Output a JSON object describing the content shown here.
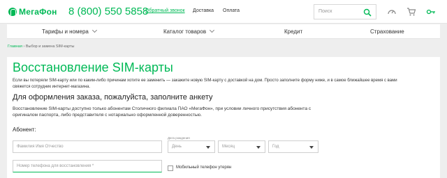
{
  "header": {
    "logo": "МегаФон",
    "phone": "8 (800) 550 5858",
    "callback": "Обратный звонок",
    "links": [
      "Доставка",
      "Оплата"
    ],
    "search_placeholder": "Поиск"
  },
  "menu": [
    {
      "label": "Тарифы и номера"
    },
    {
      "label": "Каталог товаров"
    },
    {
      "label": "Кредит"
    },
    {
      "label": "Страхование"
    }
  ],
  "breadcrumb": {
    "home": "Главная",
    "separator": "›",
    "current": "Выбор и замена SIM-карты"
  },
  "page": {
    "title": "Восстановление SIM-карты",
    "intro": "Если вы потеряли SIM-карту или по каким-либо причинам хотите ее заменить — закажите новую SIM-карту с доставкой на дом. Просто заполните форму ниже, и в самое ближайшее время с вами свяжется сотрудник интернет-магазина.",
    "subtitle": "Для оформления заказа, пожалуйста, заполните анкету",
    "description": "Восстановление SIM-карты доступно только абонентам Столичного филиала ПАО «МегаФон», при условии личного присутствия абонента с оригиналом паспорта, либо представителя с нотариально оформленной доверенностью."
  },
  "form": {
    "section_label": "Абонент:",
    "name_placeholder": "Фамилия Имя Отчество",
    "birth_label": "Дата рождения",
    "day_placeholder": "День",
    "month_placeholder": "Месяц",
    "year_placeholder": "Год",
    "phone_placeholder": "Номер телефона для восстановления *",
    "lost_checkbox_label": "Мобильный телефон утерян",
    "lost_checked": false
  },
  "colors": {
    "brand": "#00b956",
    "background": "#eeeeee"
  }
}
